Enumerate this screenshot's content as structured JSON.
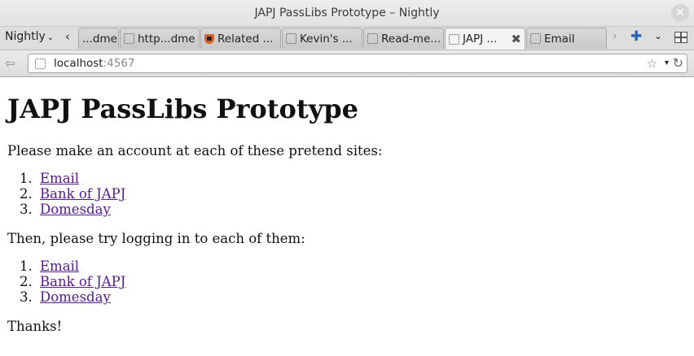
{
  "window": {
    "title": "JAPJ PassLibs Prototype – Nightly",
    "close_glyph": "✕"
  },
  "tabstrip": {
    "menu_label": "Nightly",
    "menu_chevron": "⌄",
    "scroll_left_glyph": "‹",
    "scroll_right_glyph": "›",
    "new_tab_glyph": "✚",
    "all_tabs_glyph": "⌄",
    "tabs": [
      {
        "label": "...dme",
        "icon": "none"
      },
      {
        "label": "http...dme",
        "icon": "blank-page-icon"
      },
      {
        "label": "Related ...",
        "icon": "shield-icon"
      },
      {
        "label": "Kevin's ...",
        "icon": "blank-page-icon"
      },
      {
        "label": "Read-me...",
        "icon": "blank-page-icon"
      },
      {
        "label": "JAPJ ...",
        "icon": "blank-page-icon",
        "active": true
      },
      {
        "label": "Email",
        "icon": "blank-page-icon"
      }
    ],
    "active_tab_close_glyph": "✖"
  },
  "navbar": {
    "back_glyph": "⇦",
    "url_host": "localhost",
    "url_port": ":4567",
    "star_glyph": "☆",
    "dropdown_glyph": "▾",
    "reload_glyph": "↻"
  },
  "page": {
    "heading": "JAPJ PassLibs Prototype",
    "intro": "Please make an account at each of these pretend sites:",
    "signup_links": [
      {
        "num": "1.",
        "label": "Email"
      },
      {
        "num": "2.",
        "label": "Bank of JAPJ"
      },
      {
        "num": "3.",
        "label": "Domesday"
      }
    ],
    "login_intro": "Then, please try logging in to each of them:",
    "login_links": [
      {
        "num": "1.",
        "label": "Email"
      },
      {
        "num": "2.",
        "label": "Bank of JAPJ"
      },
      {
        "num": "3.",
        "label": "Domesday"
      }
    ],
    "thanks": "Thanks!"
  },
  "colors": {
    "visited_link": "#551a8b",
    "new_tab_accent": "#2d62b6"
  }
}
